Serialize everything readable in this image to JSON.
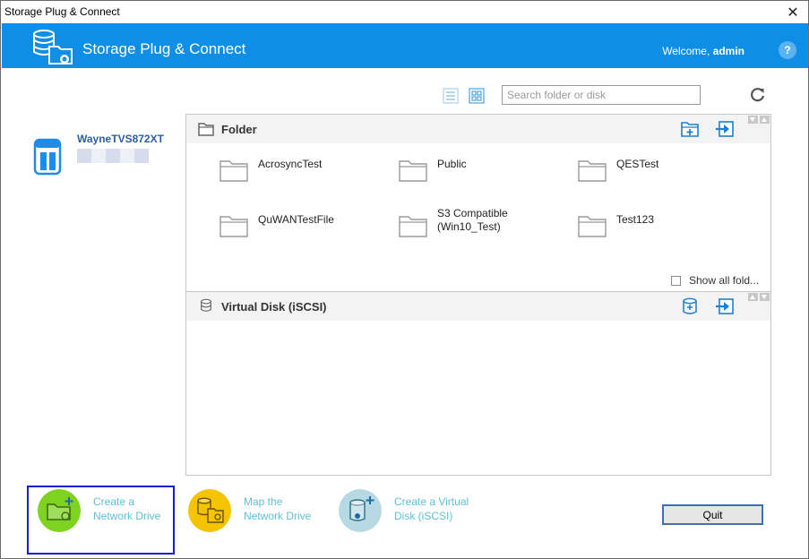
{
  "window": {
    "title": "Storage Plug & Connect",
    "close_glyph": "✕"
  },
  "header": {
    "app_name": "Storage Plug & Connect",
    "welcome_prefix": "Welcome, ",
    "user": "admin",
    "help_glyph": "?",
    "color": "#0f8ee6"
  },
  "device": {
    "name": "WayneTVS872XT",
    "icon": "nas-icon"
  },
  "toolbar": {
    "search_placeholder": "Search folder or disk",
    "view_list_icon": "list-view-icon",
    "view_grid_icon": "grid-view-icon",
    "refresh_icon": "refresh-icon"
  },
  "folder_panel": {
    "title": "Folder",
    "folders": [
      {
        "name": "AcrosyncTest"
      },
      {
        "name": "Public"
      },
      {
        "name": "QESTest"
      },
      {
        "name": "QuWANTestFile"
      },
      {
        "name": "S3 Compatible\n(Win10_Test)"
      },
      {
        "name": "Test123"
      }
    ],
    "show_all_label": "Show all fold..."
  },
  "disk_panel": {
    "title": "Virtual Disk (iSCSI)"
  },
  "actions": [
    {
      "label": "Create a\nNetwork Drive",
      "color": "#7ed321",
      "icon": "create-network-drive-icon"
    },
    {
      "label": "Map the\nNetwork Drive",
      "color": "#f5c400",
      "icon": "map-network-drive-icon"
    },
    {
      "label": "Create a Virtual\nDisk (iSCSI)",
      "color": "#b7d9e3",
      "icon": "create-virtual-disk-icon"
    }
  ],
  "quit_label": "Quit"
}
